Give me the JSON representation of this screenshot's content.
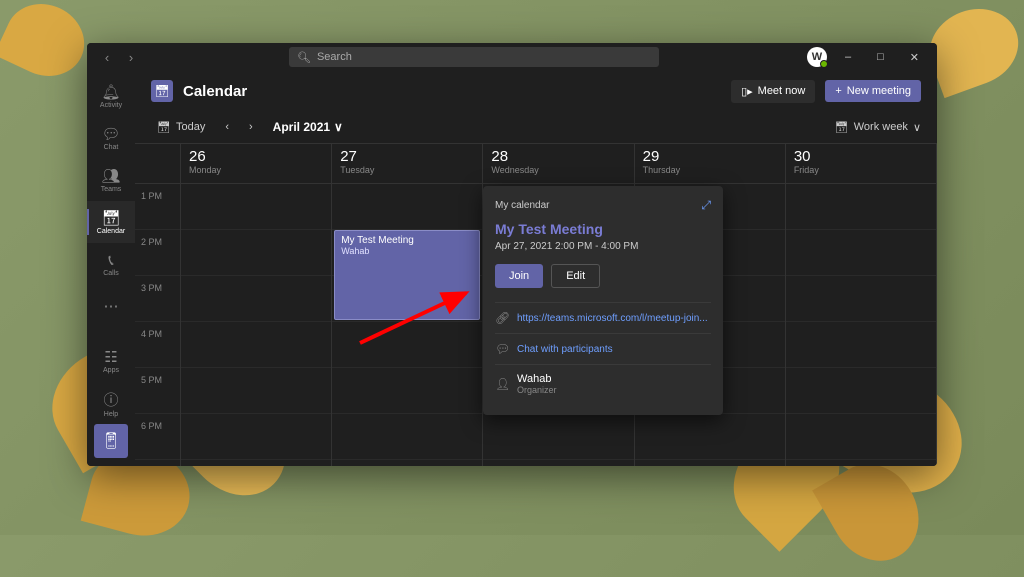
{
  "search": {
    "placeholder": "Search"
  },
  "avatar_letter": "W",
  "sidebar": {
    "items": [
      {
        "label": "Activity"
      },
      {
        "label": "Chat"
      },
      {
        "label": "Teams"
      },
      {
        "label": "Calendar"
      },
      {
        "label": "Calls"
      }
    ],
    "apps": "Apps",
    "help": "Help"
  },
  "header": {
    "title": "Calendar",
    "meet_now": "Meet now",
    "new_meeting": "New meeting"
  },
  "toolbar": {
    "today": "Today",
    "month": "April 2021",
    "view": "Work week"
  },
  "days": [
    {
      "num": "26",
      "name": "Monday"
    },
    {
      "num": "27",
      "name": "Tuesday"
    },
    {
      "num": "28",
      "name": "Wednesday"
    },
    {
      "num": "29",
      "name": "Thursday"
    },
    {
      "num": "30",
      "name": "Friday"
    }
  ],
  "hours": [
    "1 PM",
    "2 PM",
    "3 PM",
    "4 PM",
    "5 PM",
    "6 PM"
  ],
  "event": {
    "title": "My Test Meeting",
    "organizer": "Wahab"
  },
  "popover": {
    "calendar_name": "My calendar",
    "title": "My Test Meeting",
    "time": "Apr 27, 2021 2:00 PM - 4:00 PM",
    "join": "Join",
    "edit": "Edit",
    "link": "https://teams.microsoft.com/l/meetup-join...",
    "chat": "Chat with participants",
    "organizer_name": "Wahab",
    "organizer_role": "Organizer"
  }
}
